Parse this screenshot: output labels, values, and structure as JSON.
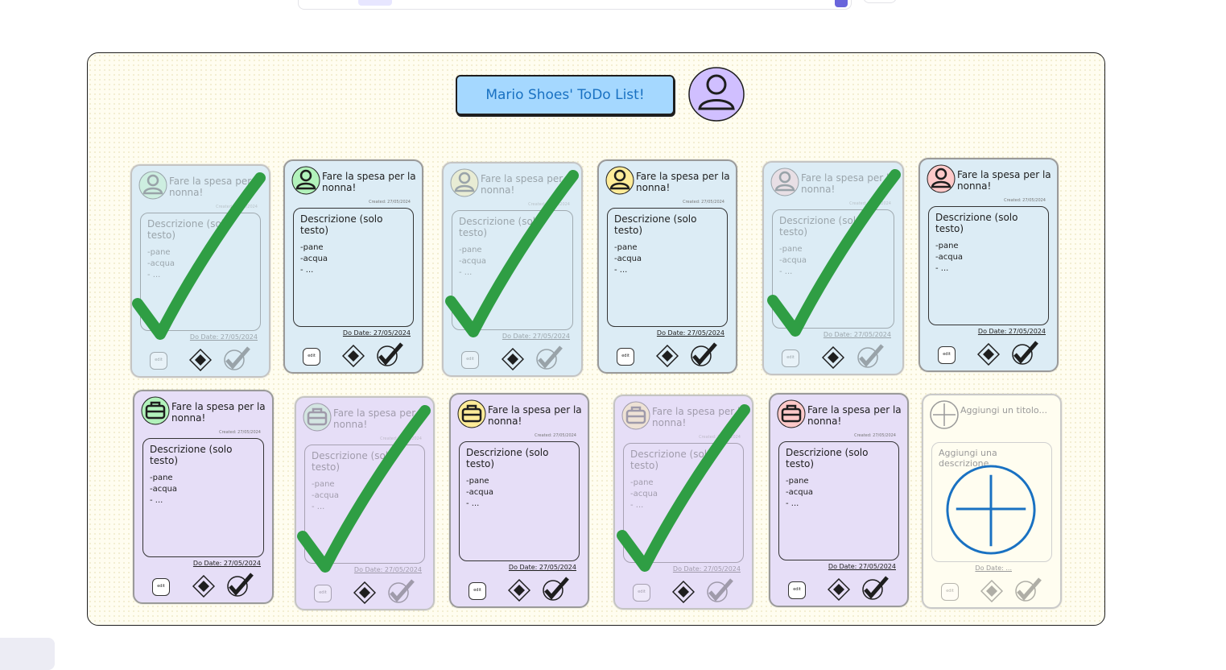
{
  "board_title": "Mario Shoes' ToDo List!",
  "card_template": {
    "title": "Fare la spesa per la nonna!",
    "desc_title": "Descrizione (solo testo)",
    "desc_lines": [
      "-pane",
      "-acqua",
      "- ..."
    ],
    "created": "Created: 27/05/2024",
    "due": "Do Date: 27/05/2024",
    "edit_label": "edit"
  },
  "new_card": {
    "title_placeholder": "Aggiungi un titolo...",
    "desc_placeholder": "Aggiungi una descrizione...",
    "due_placeholder": "Do Date: ..."
  },
  "avatar_colors": {
    "main": "#d0bfff",
    "green": "#b2f2bb",
    "yellow": "#ffec99",
    "pink": "#ffc9c9"
  },
  "card_colors": {
    "blue": "#dcecf5",
    "purple": "#e6def7"
  }
}
